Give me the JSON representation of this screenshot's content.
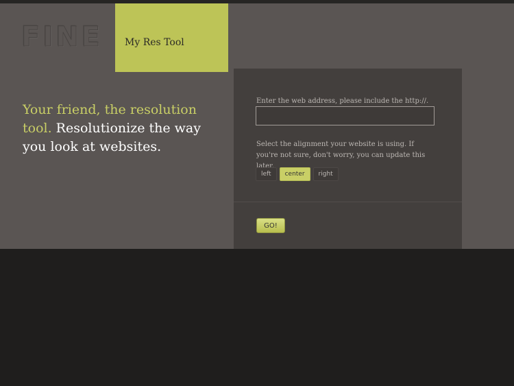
{
  "header": {
    "logo": "FINE",
    "tab_label": "My Res Tool"
  },
  "hero": {
    "accent": "Your friend, the resolution tool.",
    "rest": " Resolutionize the way you look at websites."
  },
  "form": {
    "url_label": "Enter the web address, please include the http://.",
    "url_value": "",
    "alignment_label": "Select the alignment your website is using. If you're not sure, don't worry, you can update this later.",
    "alignment_options": [
      "left",
      "center",
      "right"
    ],
    "alignment_selected": "center",
    "go_label": "GO!"
  },
  "colors": {
    "accent": "#bdc457",
    "header_bg": "#5a5553",
    "panel_bg": "#433f3d",
    "page_bg": "#1f1e1d"
  }
}
